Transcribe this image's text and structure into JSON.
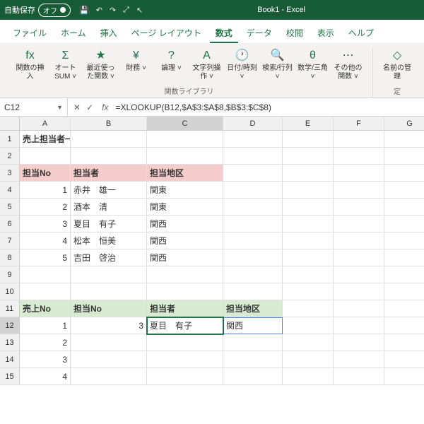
{
  "titlebar": {
    "autosave": "自動保存",
    "autosave_state": "オフ",
    "title": "Book1 - Excel"
  },
  "tabs": [
    "ファイル",
    "ホーム",
    "挿入",
    "ページ レイアウト",
    "数式",
    "データ",
    "校閲",
    "表示",
    "ヘルプ"
  ],
  "active_tab": 4,
  "ribbon": {
    "items": [
      {
        "icon": "fx",
        "label": "関数の挿入"
      },
      {
        "icon": "Σ",
        "label": "オート SUM ˅"
      },
      {
        "icon": "★",
        "label": "最近使った関数 ˅"
      },
      {
        "icon": "¥",
        "label": "財務 ˅"
      },
      {
        "icon": "?",
        "label": "論理 ˅"
      },
      {
        "icon": "A",
        "label": "文字列操作 ˅"
      },
      {
        "icon": "🕐",
        "label": "日付/時刻 ˅"
      },
      {
        "icon": "🔍",
        "label": "検索/行列 ˅"
      },
      {
        "icon": "θ",
        "label": "数学/三角 ˅"
      },
      {
        "icon": "⋯",
        "label": "その他の関数 ˅"
      }
    ],
    "group_label": "関数ライブラリ",
    "right": [
      {
        "icon": "◇",
        "label": "名前の管理"
      }
    ],
    "right_label": "定"
  },
  "namebox": "C12",
  "formula": "=XLOOKUP(B12,$A$3:$A$8,$B$3:$C$8)",
  "cols": [
    "A",
    "B",
    "C",
    "D",
    "E",
    "F",
    "G"
  ],
  "rows": 15,
  "cells": {
    "A1": {
      "v": "売上担当者一覧",
      "bold": true
    },
    "A3": {
      "v": "担当No",
      "bold": true,
      "cls": "pink"
    },
    "B3": {
      "v": "担当者",
      "bold": true,
      "cls": "pink"
    },
    "C3": {
      "v": "担当地区",
      "bold": true,
      "cls": "pink"
    },
    "A4": {
      "v": "1",
      "num": true
    },
    "B4": {
      "v": "赤井　雄一"
    },
    "C4": {
      "v": "関東"
    },
    "A5": {
      "v": "2",
      "num": true
    },
    "B5": {
      "v": "酒本　清"
    },
    "C5": {
      "v": "関東"
    },
    "A6": {
      "v": "3",
      "num": true
    },
    "B6": {
      "v": "夏目　有子"
    },
    "C6": {
      "v": "関西"
    },
    "A7": {
      "v": "4",
      "num": true
    },
    "B7": {
      "v": "松本　恒美"
    },
    "C7": {
      "v": "関西"
    },
    "A8": {
      "v": "5",
      "num": true
    },
    "B8": {
      "v": "吉田　啓治"
    },
    "C8": {
      "v": "関西"
    },
    "A11": {
      "v": "売上No",
      "bold": true,
      "cls": "green"
    },
    "B11": {
      "v": "担当No",
      "bold": true,
      "cls": "green"
    },
    "C11": {
      "v": "担当者",
      "bold": true,
      "cls": "green"
    },
    "D11": {
      "v": "担当地区",
      "bold": true,
      "cls": "green"
    },
    "A12": {
      "v": "1",
      "num": true
    },
    "B12": {
      "v": "3",
      "num": true
    },
    "C12": {
      "v": "夏目　有子",
      "active": true
    },
    "D12": {
      "v": "関西",
      "spill": true
    },
    "A13": {
      "v": "2",
      "num": true
    },
    "A14": {
      "v": "3",
      "num": true
    },
    "A15": {
      "v": "4",
      "num": true
    }
  },
  "chart_data": {
    "type": "table",
    "title": "売上担当者一覧",
    "columns": [
      "担当No",
      "担当者",
      "担当地区"
    ],
    "rows": [
      [
        1,
        "赤井　雄一",
        "関東"
      ],
      [
        2,
        "酒本　清",
        "関東"
      ],
      [
        3,
        "夏目　有子",
        "関西"
      ],
      [
        4,
        "松本　恒美",
        "関西"
      ],
      [
        5,
        "吉田　啓治",
        "関西"
      ]
    ],
    "lookup": {
      "columns": [
        "売上No",
        "担当No",
        "担当者",
        "担当地区"
      ],
      "rows": [
        [
          1,
          3,
          "夏目　有子",
          "関西"
        ],
        [
          2,
          null,
          null,
          null
        ],
        [
          3,
          null,
          null,
          null
        ],
        [
          4,
          null,
          null,
          null
        ]
      ]
    }
  }
}
